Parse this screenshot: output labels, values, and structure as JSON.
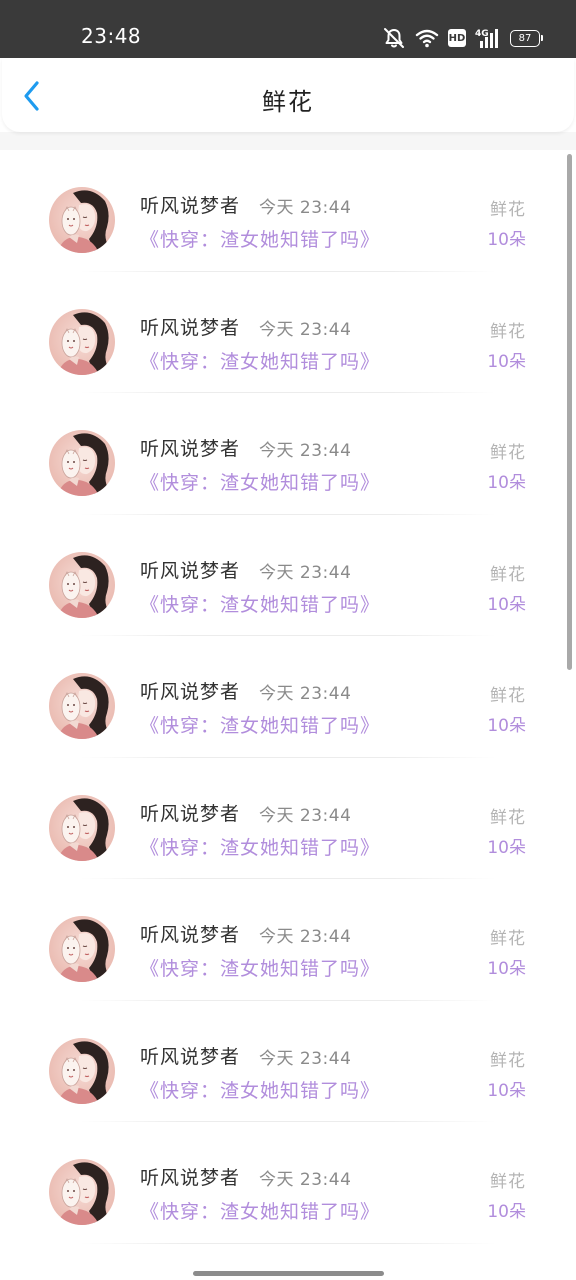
{
  "status_bar": {
    "time": "23:48",
    "hd": "HD",
    "network": "4G",
    "battery": "87",
    "icons": [
      "bell-mute-icon",
      "wifi-icon",
      "hd-icon",
      "signal-icon",
      "battery-icon"
    ]
  },
  "header": {
    "title": "鲜花",
    "back_icon": "chevron-left-icon"
  },
  "colors": {
    "accent": "#b18ddc",
    "back_arrow": "#1e9bef",
    "status_bar_bg": "#3a3a3a",
    "text_primary": "#333333",
    "text_secondary": "#8a8a8a"
  },
  "items": [
    {
      "user": "听风说梦者",
      "time": "今天 23:44",
      "book": "《快穿：渣女她知错了吗》",
      "gift": "鲜花",
      "count": "10朵"
    },
    {
      "user": "听风说梦者",
      "time": "今天 23:44",
      "book": "《快穿：渣女她知错了吗》",
      "gift": "鲜花",
      "count": "10朵"
    },
    {
      "user": "听风说梦者",
      "time": "今天 23:44",
      "book": "《快穿：渣女她知错了吗》",
      "gift": "鲜花",
      "count": "10朵"
    },
    {
      "user": "听风说梦者",
      "time": "今天 23:44",
      "book": "《快穿：渣女她知错了吗》",
      "gift": "鲜花",
      "count": "10朵"
    },
    {
      "user": "听风说梦者",
      "time": "今天 23:44",
      "book": "《快穿：渣女她知错了吗》",
      "gift": "鲜花",
      "count": "10朵"
    },
    {
      "user": "听风说梦者",
      "time": "今天 23:44",
      "book": "《快穿：渣女她知错了吗》",
      "gift": "鲜花",
      "count": "10朵"
    },
    {
      "user": "听风说梦者",
      "time": "今天 23:44",
      "book": "《快穿：渣女她知错了吗》",
      "gift": "鲜花",
      "count": "10朵"
    },
    {
      "user": "听风说梦者",
      "time": "今天 23:44",
      "book": "《快穿：渣女她知错了吗》",
      "gift": "鲜花",
      "count": "10朵"
    },
    {
      "user": "听风说梦者",
      "time": "今天 23:44",
      "book": "《快穿：渣女她知错了吗》",
      "gift": "鲜花",
      "count": "10朵"
    }
  ]
}
